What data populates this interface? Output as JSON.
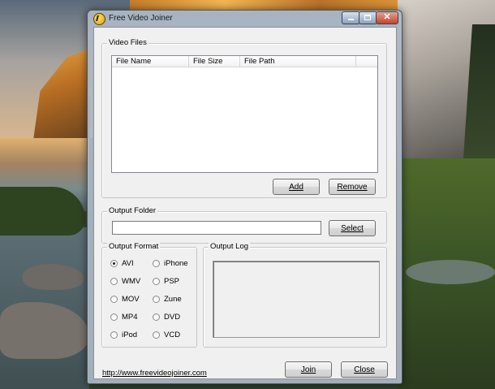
{
  "window": {
    "title": "Free Video Joiner",
    "controls": {
      "minimize": "minimize",
      "maximize": "maximize",
      "close": "close"
    }
  },
  "video_files": {
    "legend": "Video Files",
    "columns": [
      "File Name",
      "File Size",
      "File Path"
    ],
    "rows": [],
    "add_label": "Add",
    "remove_label": "Remove"
  },
  "output_folder": {
    "legend": "Output Folder",
    "value": "",
    "select_label": "Select"
  },
  "output_format": {
    "legend": "Output Format",
    "options": [
      "AVI",
      "WMV",
      "MOV",
      "MP4",
      "iPod",
      "iPhone",
      "PSP",
      "Zune",
      "DVD",
      "VCD"
    ],
    "selected": "AVI"
  },
  "output_log": {
    "legend": "Output Log",
    "content": ""
  },
  "footer": {
    "link": "http://www.freevideojoiner.com",
    "join_label": "Join",
    "close_label": "Close"
  },
  "colors": {
    "window_frame": "#acb8c6",
    "client_bg": "#f0f0f0",
    "close_button": "#c1442b"
  }
}
